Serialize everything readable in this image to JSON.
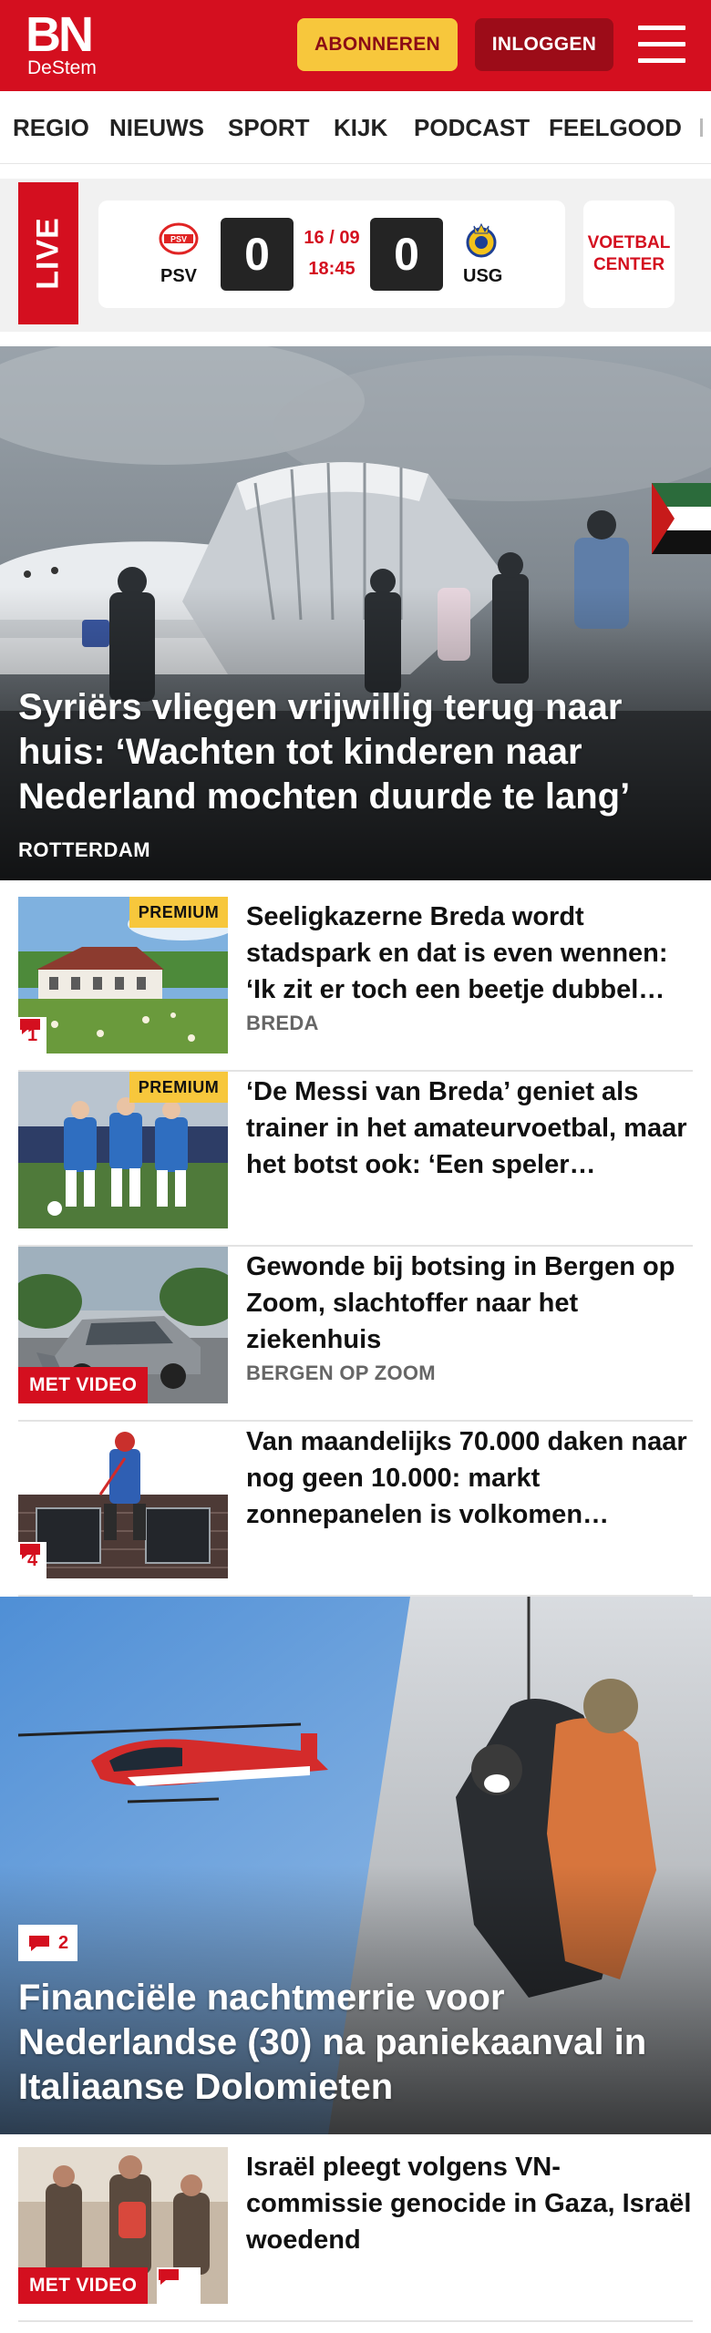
{
  "header": {
    "logo_main": "BN",
    "logo_sub": "DeStem",
    "subscribe_label": "ABONNEREN",
    "login_label": "INLOGGEN",
    "brand_color": "#d40f1f",
    "accent_color": "#f7c73c"
  },
  "nav": {
    "items": [
      "REGIO",
      "NIEUWS",
      "SPORT",
      "KIJK",
      "PODCAST",
      "FEELGOOD"
    ]
  },
  "live": {
    "label": "LIVE",
    "home_team": "PSV",
    "home_score": "0",
    "away_team": "USG",
    "away_score": "0",
    "date": "16 / 09",
    "time": "18:45",
    "center_label": "VOETBAL CENTER"
  },
  "hero": {
    "title": "Syriërs vliegen vrijwillig terug naar huis: ‘Wachten tot kinderen naar Nederland mochten duurde te lang’",
    "location": "ROTTERDAM"
  },
  "articles": [
    {
      "title": "Seeligkazerne Breda wordt stadspark en dat is even wennen: ‘Ik zit er toch een beetje dubbel…",
      "location": "BREDA",
      "premium": "PREMIUM",
      "comments": "1"
    },
    {
      "title": "‘De Messi van Breda’ geniet als trainer in het amateurvoetbal, maar het botst ook: ‘Een speler…",
      "premium": "PREMIUM"
    },
    {
      "title": "Gewonde bij botsing in Bergen op Zoom, slachtoffer naar het ziekenhuis",
      "location": "BERGEN OP ZOOM",
      "video": "MET VIDEO"
    },
    {
      "title": "Van maandelijks 70.000 daken naar nog geen 10.000: markt zonnepanelen is volkomen…",
      "comments": "4"
    }
  ],
  "hero2": {
    "title": "Financiële nachtmerrie voor Nederlandse (30) na paniekaanval in Italiaanse Dolomieten",
    "comments": "2"
  },
  "article_last": {
    "title": "Israël pleegt volgens VN-commissie genocide in Gaza, Israël woedend",
    "video": "MET VIDEO"
  }
}
